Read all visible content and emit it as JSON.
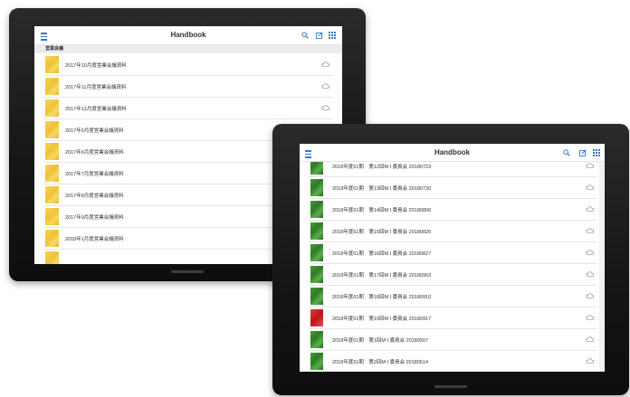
{
  "colors": {
    "accent": "#2f7ad0",
    "bezel": "#1a1a1a"
  },
  "tablet_back": {
    "app_title": "Handbook",
    "icons": [
      "menu-icon",
      "search-icon",
      "edit-icon",
      "grid-icon"
    ],
    "section_header": "営業会議",
    "items": [
      {
        "label": "2017年10月度営業会議資料",
        "status": "cloud-icon"
      },
      {
        "label": "2017年11月度営業会議資料",
        "status": "cloud-icon"
      },
      {
        "label": "2017年12月度営業会議資料",
        "status": "cloud-icon"
      },
      {
        "label": "2017年5月度営業会議資料"
      },
      {
        "label": "2017年6月度営業会議資料"
      },
      {
        "label": "2017年7月度営業会議資料"
      },
      {
        "label": "2017年8月度営業会議資料"
      },
      {
        "label": "2017年9月度営業会議資料"
      },
      {
        "label": "2018年1月度営業会議資料"
      }
    ]
  },
  "tablet_front": {
    "app_title": "Handbook",
    "icons": [
      "menu-icon",
      "search-icon",
      "edit-icon",
      "grid-icon"
    ],
    "items": [
      {
        "label": "2018年度61期　第12回M I 委員会 20180723",
        "status": "cloud-icon"
      },
      {
        "label": "2018年度61期　第13回M I 委員会 20180730",
        "status": "cloud-icon"
      },
      {
        "label": "2018年度61期　第14回M I 委員会 20180806",
        "status": "cloud-icon"
      },
      {
        "label": "2018年度61期　第15回M I 委員会 20180820",
        "status": "cloud-icon"
      },
      {
        "label": "2018年度61期　第16回M I 委員会 20180827",
        "status": "cloud-icon"
      },
      {
        "label": "2018年度61期　第17回M I 委員会 20180903",
        "status": "cloud-icon"
      },
      {
        "label": "2018年度61期　第18回M I 委員会 20180910",
        "status": "cloud-icon"
      },
      {
        "label": "2018年度61期　第19回M I 委員会 20180917",
        "status": "cloud-icon"
      },
      {
        "label": "2018年度61期　第1回M I 委員会 20180507",
        "status": "cloud-icon"
      },
      {
        "label": "2018年度61期　第2回M I 委員会 20180514",
        "status": "cloud-icon"
      }
    ]
  }
}
